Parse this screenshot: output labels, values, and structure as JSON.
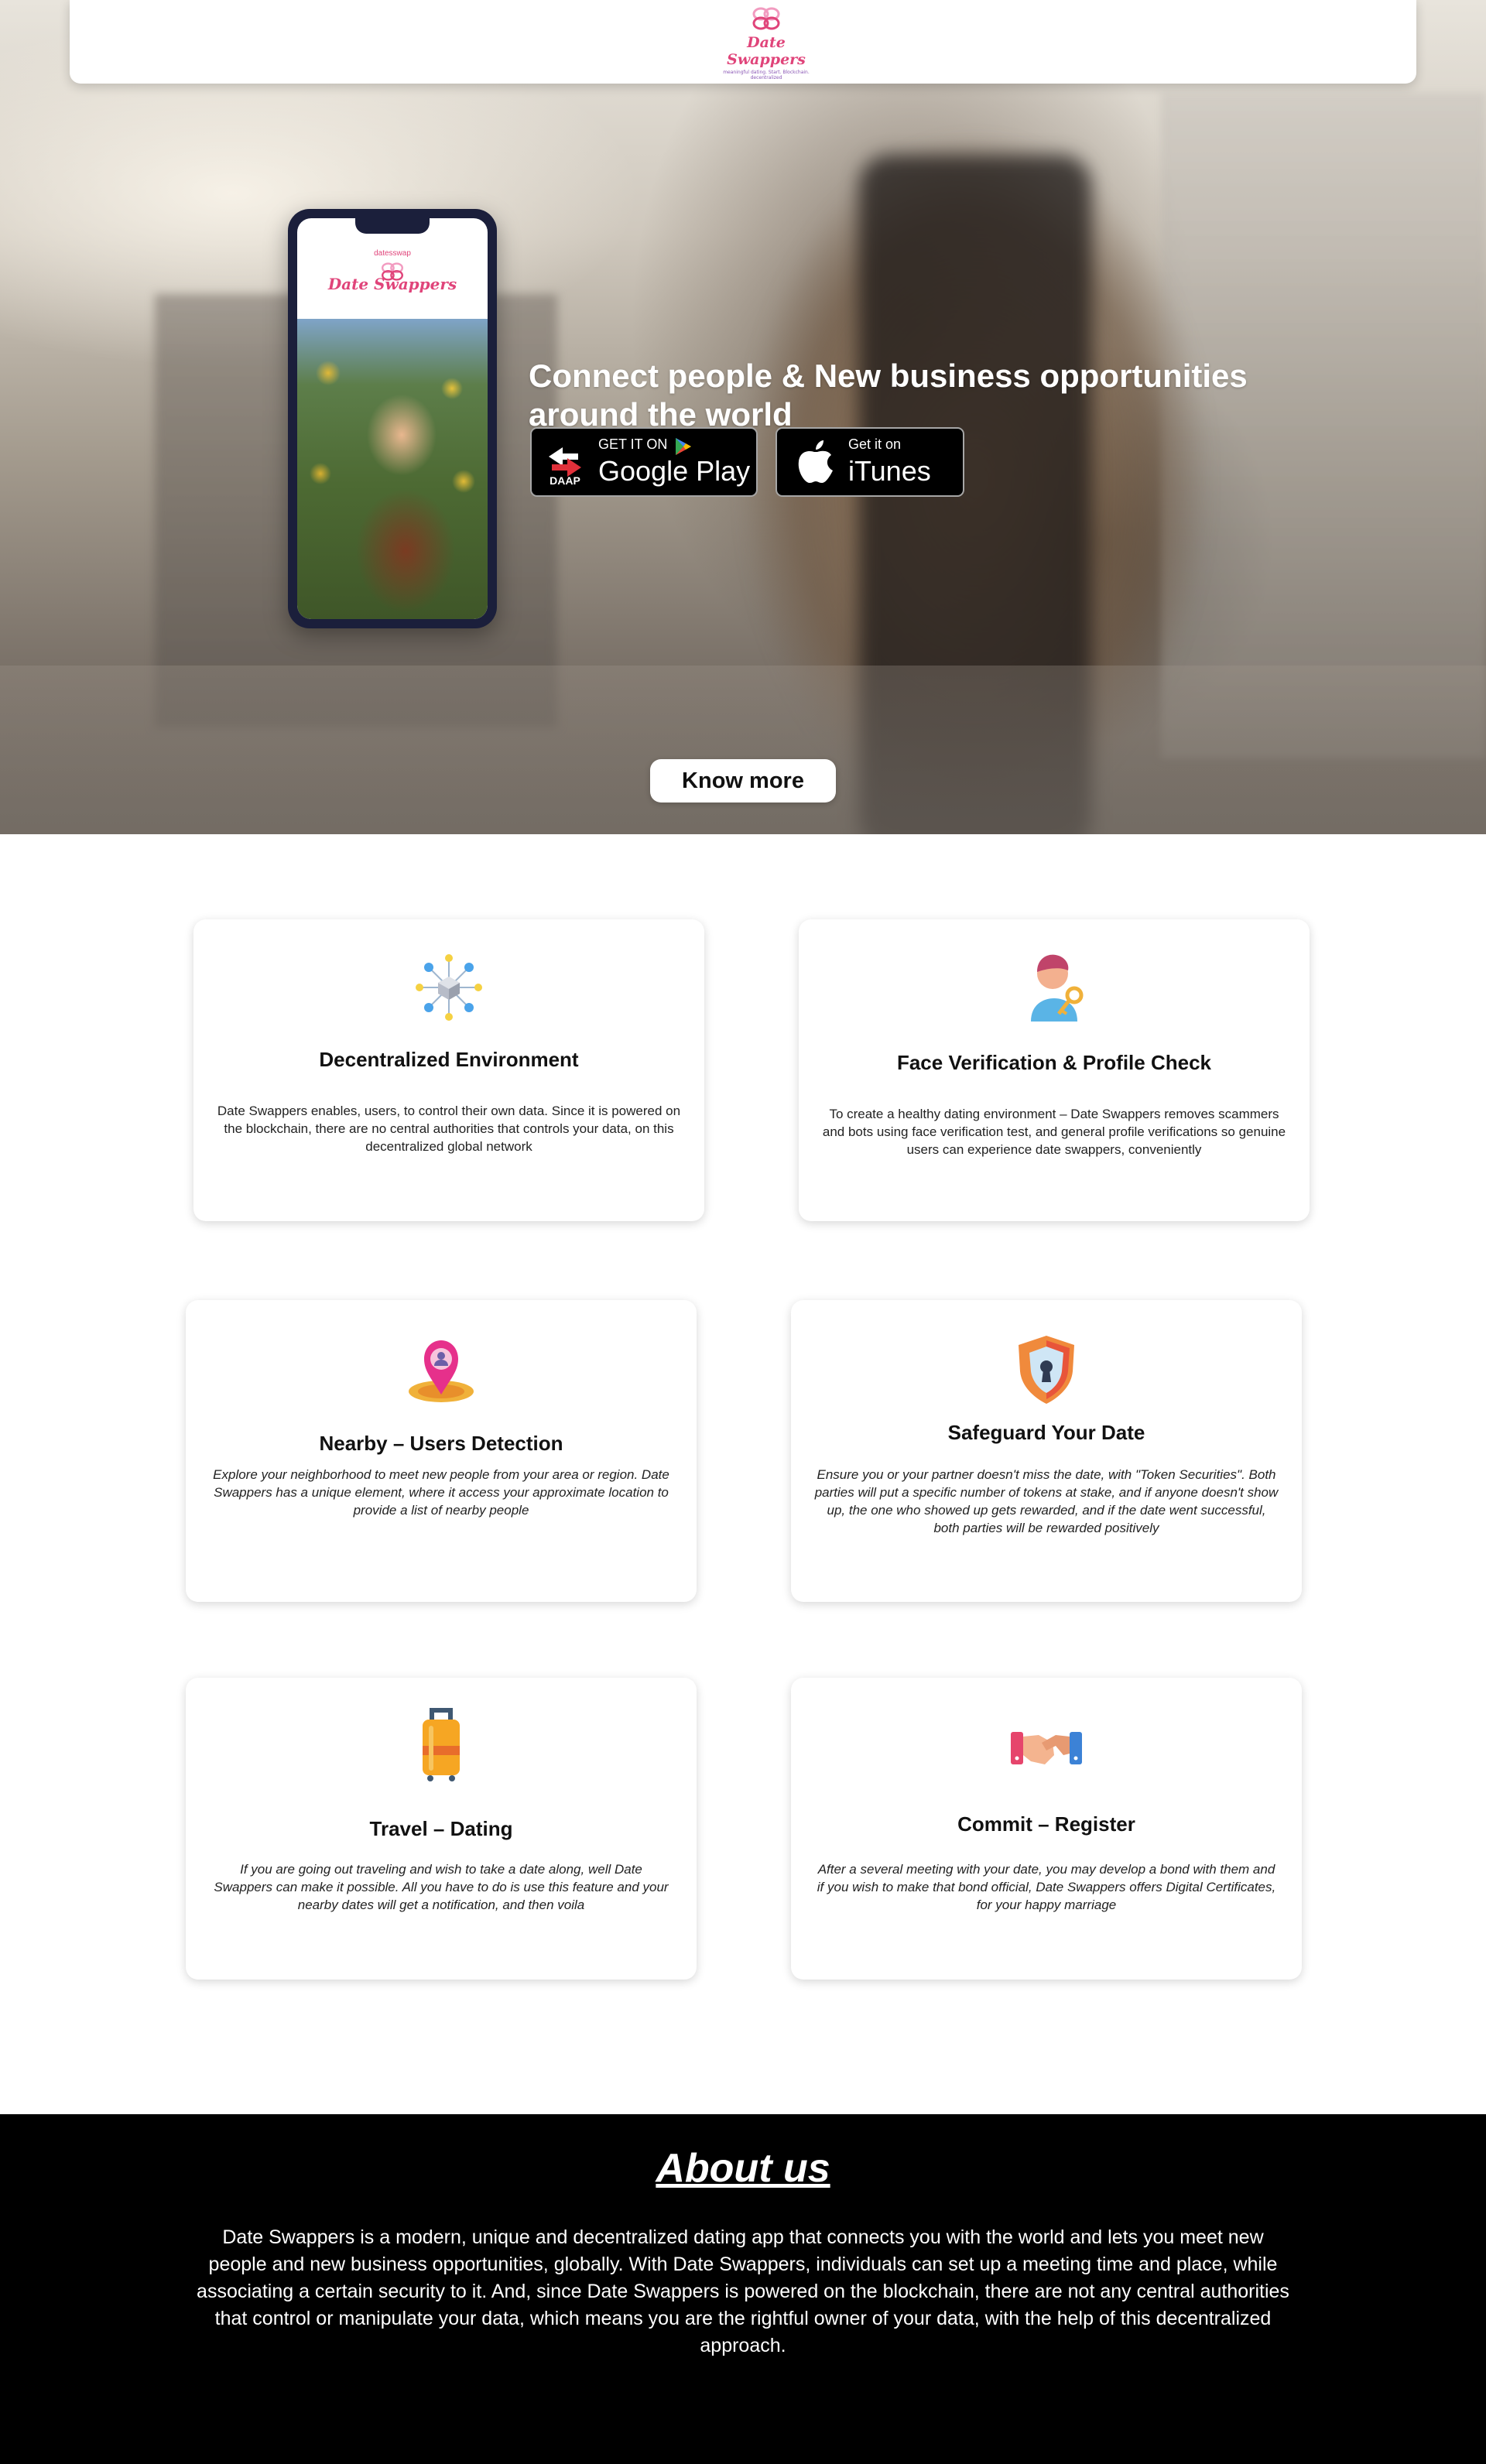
{
  "brand": {
    "top": "datesswap",
    "name": "Date Swappers",
    "tagline": "meaningful dating. Start. Blockchain. decentralized"
  },
  "hero": {
    "title": "Connect people & New business opportunities around the world",
    "google_play": {
      "small": "GET IT ON",
      "big": "Google Play",
      "badge": "DAAP"
    },
    "itunes": {
      "small": "Get it on",
      "big": "iTunes"
    },
    "know_more": "Know more"
  },
  "features": [
    {
      "icon": "decentralized-network-icon",
      "title": "Decentralized Environment",
      "text": "Date Swappers enables, users, to control their own data. Since it is powered on the blockchain, there are no central authorities that controls your data, on this decentralized global network"
    },
    {
      "icon": "face-verification-key-icon",
      "title": "Face Verification & Profile Check",
      "text": "To create a healthy dating environment – Date Swappers removes scammers and bots using face verification test, and general profile verifications so genuine users can experience date swappers, conveniently"
    },
    {
      "icon": "location-pin-icon",
      "title": "Nearby – Users Detection",
      "text": "Explore your neighborhood to meet new people from your area or region. Date Swappers has a unique element, where it access your approximate location to provide a list of nearby people"
    },
    {
      "icon": "shield-lock-icon",
      "title": "Safeguard Your Date",
      "text": "Ensure you or your partner doesn't miss the date, with \"Token Securities\". Both parties will put a specific number of tokens at stake, and if anyone doesn't show up, the one who showed up gets rewarded, and if the date went successful, both parties will be rewarded positively"
    },
    {
      "icon": "suitcase-icon",
      "title": "Travel – Dating",
      "text": "If you are going out traveling and wish to take a date along, well Date Swappers can make it possible. All you have to do is use this feature and your nearby dates will get a notification, and then voila"
    },
    {
      "icon": "handshake-icon",
      "title": "Commit – Register",
      "text": "After a several meeting with your date, you may develop a bond with them and if you wish to make that bond official, Date Swappers offers Digital Certificates, for your happy marriage"
    }
  ],
  "about": {
    "title": "About us",
    "text": "Date Swappers is a modern, unique and decentralized dating app that connects you with the world and lets you meet new people and new business opportunities, globally. With Date Swappers, individuals can set up a meeting time and place, while associating a certain security to it. And, since Date Swappers is powered on the blockchain, there are not any central authorities that control or manipulate your data, which means you are the rightful owner of your data, with the help of this decentralized approach."
  },
  "colors": {
    "brand_pink": "#e0447a",
    "phone_frame": "#1b1f3b",
    "about_bg": "#000000"
  }
}
